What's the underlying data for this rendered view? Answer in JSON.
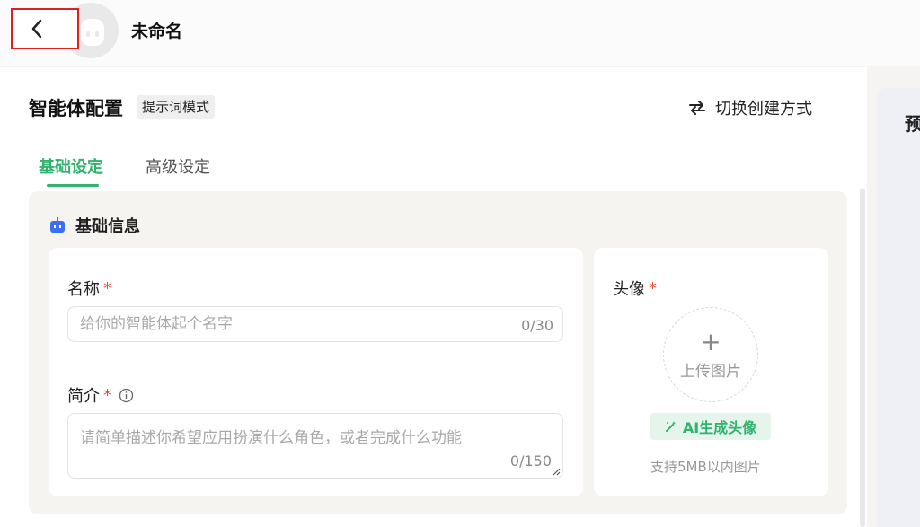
{
  "header": {
    "title": "未命名"
  },
  "config": {
    "title": "智能体配置",
    "mode_badge": "提示词模式",
    "switch_label": "切换创建方式",
    "tabs": [
      "基础设定",
      "高级设定"
    ],
    "basic": {
      "title": "基础信息",
      "name": {
        "label": "名称",
        "required": "*",
        "placeholder": "给你的智能体起个名字",
        "counter": "0/30"
      },
      "intro": {
        "label": "简介",
        "required": "*",
        "placeholder": "请简单描述你希望应用扮演什么角色，或者完成什么功能",
        "counter": "0/150"
      },
      "avatar": {
        "label": "头像",
        "required": "*",
        "upload_label": "上传图片",
        "ai_button": "AI生成头像",
        "hint": "支持5MB以内图片"
      }
    }
  },
  "preview": {
    "title_fragment": "预"
  },
  "colors": {
    "accent": "#2fb36d",
    "required": "#e34d3b",
    "highlight_border": "#e02020"
  }
}
